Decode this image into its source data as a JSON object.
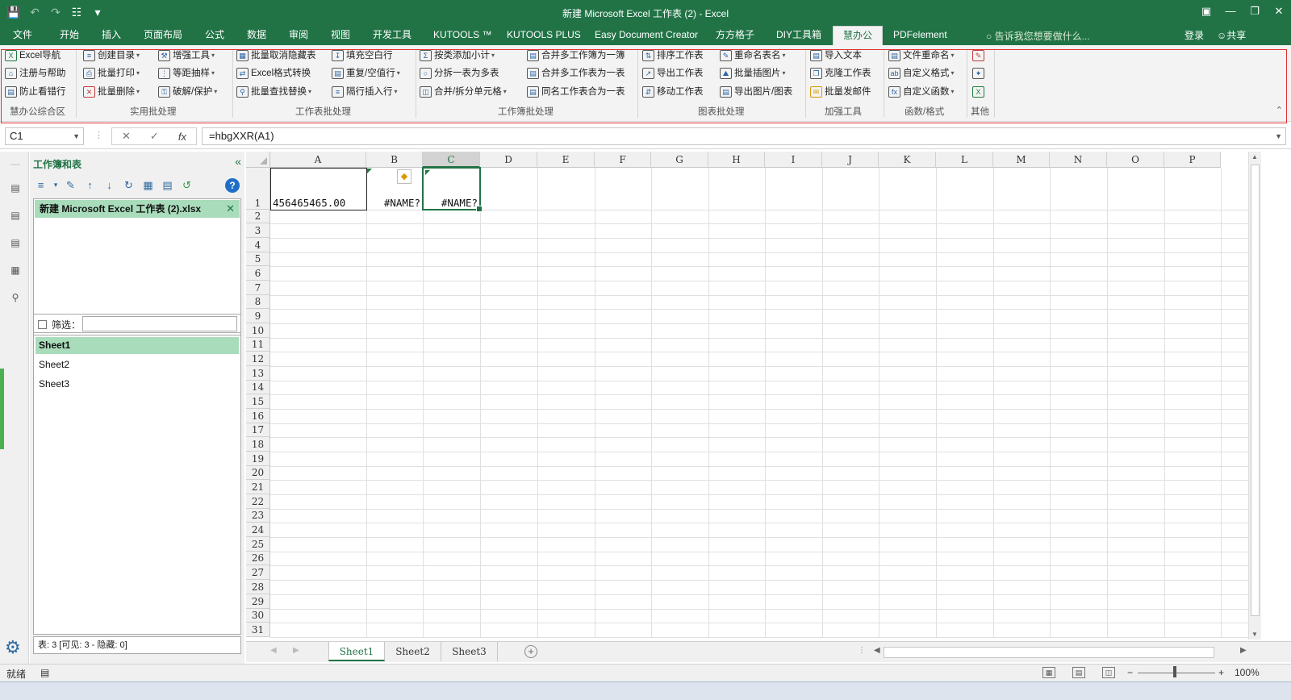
{
  "app": {
    "title": "新建 Microsoft Excel 工作表 (2) - Excel"
  },
  "ribbon_tabs": [
    "文件",
    "开始",
    "插入",
    "页面布局",
    "公式",
    "数据",
    "审阅",
    "视图",
    "开发工具",
    "KUTOOLS ™",
    "KUTOOLS PLUS",
    "Easy Document Creator",
    "方方格子",
    "DIY工具箱",
    "慧办公",
    "PDFelement"
  ],
  "active_tab": "慧办公",
  "tell_me": "告诉我您想要做什么...",
  "login": "登录",
  "share": "共享",
  "ribbon": {
    "c1": [
      "Excel导航",
      "注册与帮助",
      "防止看错行"
    ],
    "c2": [
      "创建目录",
      "批量打印",
      "批量删除"
    ],
    "c3": [
      "增强工具",
      "等距抽样",
      "破解/保护"
    ],
    "c4": [
      "批量取消隐藏表",
      "Excel格式转换",
      "批量查找替换"
    ],
    "c5": [
      "填充空白行",
      "重复/空值行",
      "隔行插入行"
    ],
    "c6": [
      "按类添加小计",
      "分拆一表为多表",
      "合并/拆分单元格"
    ],
    "c7": [
      "合并多工作簿为一簿",
      "合并多工作表为一表",
      "同名工作表合为一表"
    ],
    "c8": [
      "排序工作表",
      "导出工作表",
      "移动工作表"
    ],
    "c9": [
      "重命名表名",
      "批量插图片",
      "导出图片/图表"
    ],
    "c10": [
      "导入文本",
      "克隆工作表",
      "批量发邮件"
    ],
    "c11": [
      "文件重命名",
      "自定义格式",
      "自定义函数"
    ],
    "groups": [
      "慧办公综合区",
      "实用批处理",
      "工作表批处理",
      "工作簿批处理",
      "图表批处理",
      "加强工具",
      "函数/格式",
      "其他"
    ]
  },
  "formula_bar": {
    "name_box": "C1",
    "formula": "=hbgXXR(A1)",
    "fx": "fx"
  },
  "panel": {
    "title": "工作簿和表",
    "workbook": "新建 Microsoft Excel 工作表 (2).xlsx",
    "filter_label": "筛选：",
    "sheets": [
      "Sheet1",
      "Sheet2",
      "Sheet3"
    ],
    "status": "表: 3  [可见: 3 - 隐藏: 0]"
  },
  "grid": {
    "columns": [
      "A",
      "B",
      "C",
      "D",
      "E",
      "F",
      "G",
      "H",
      "I",
      "J",
      "K",
      "L",
      "M",
      "N",
      "O",
      "P"
    ],
    "rows": [
      "1",
      "2",
      "3",
      "4",
      "5",
      "6",
      "7",
      "8",
      "9",
      "10",
      "11",
      "12",
      "13",
      "14",
      "15",
      "16",
      "17",
      "18",
      "19",
      "20",
      "21",
      "22",
      "23",
      "24",
      "25",
      "26",
      "27",
      "28",
      "29",
      "30",
      "31"
    ],
    "cells": {
      "A1": "456465465.00",
      "B1": "#NAME?",
      "C1": "#NAME?"
    }
  },
  "sheet_tabs": [
    "Sheet1",
    "Sheet2",
    "Sheet3"
  ],
  "status": {
    "ready": "就绪",
    "zoom": "100%"
  }
}
